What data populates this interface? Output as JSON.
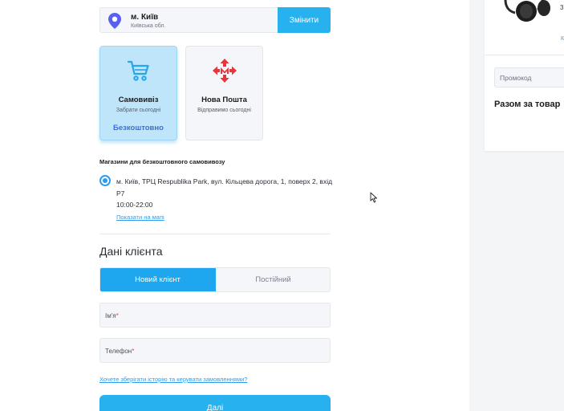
{
  "city": {
    "name": "м. Київ",
    "region": "Київська обл.",
    "change_label": "Змінити"
  },
  "delivery": [
    {
      "title": "Самовивіз",
      "subtitle": "Забрати сьогодні",
      "price": "Безкоштовно",
      "icon": "cart-icon",
      "selected": true
    },
    {
      "title": "Нова Пошта",
      "subtitle": "Відправимо сьогодні",
      "icon": "nova-poshta-logo",
      "selected": false
    }
  ],
  "stores": {
    "title": "Магазини для безкоштовного самовивозу",
    "items": [
      {
        "address": "м. Київ, ТРЦ Respublika Park, вул. Кільцева дорога, 1, поверх 2, вхід Р7",
        "hours": "10:00-22:00",
        "map_link": "Показати на мапі",
        "selected": true
      }
    ]
  },
  "client": {
    "title": "Дані клієнта",
    "tabs": [
      {
        "label": "Новий клієнт",
        "active": true
      },
      {
        "label": "Постійний",
        "active": false
      }
    ],
    "fields": {
      "name_label": "Ім'я",
      "phone_label": "Телефон",
      "required_mark": "*"
    },
    "history_link": "Хочете зберігати історію та керувати замовленнями?",
    "next_label": "Далі"
  },
  "sidebar": {
    "badge": "3",
    "small_text": "К",
    "promo_placeholder": "Промокод",
    "total_label": "Разом за товар"
  },
  "colors": {
    "accent": "#27b1ee",
    "link": "#2a9df0",
    "free": "#3b6fe0",
    "nova_poshta": "#e8343c"
  }
}
